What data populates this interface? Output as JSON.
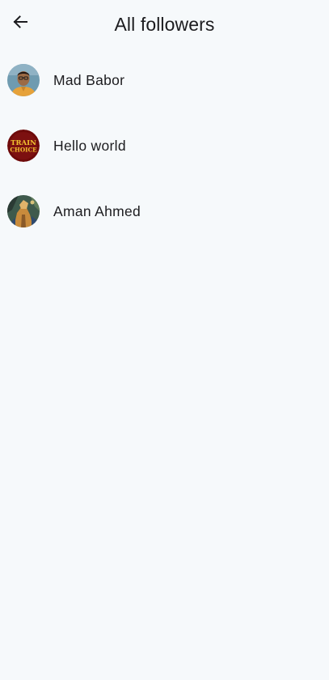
{
  "header": {
    "title": "All followers",
    "back_icon": "arrow-left-icon"
  },
  "followers": [
    {
      "name": "Mad Babor",
      "avatar": "person-photo-avatar"
    },
    {
      "name": "Hello world",
      "avatar": "train-choice-logo-avatar",
      "avatar_text": "TRAIN CHOICE"
    },
    {
      "name": "Aman Ahmed",
      "avatar": "illustration-avatar"
    }
  ]
}
